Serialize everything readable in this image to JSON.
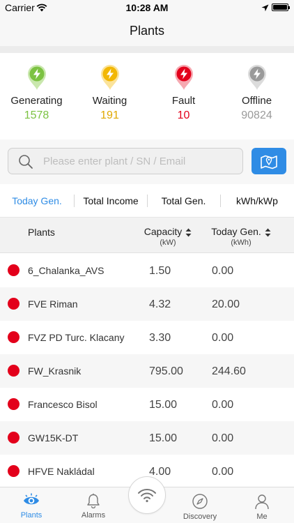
{
  "status_bar": {
    "carrier": "Carrier",
    "time": "10:28 AM"
  },
  "nav": {
    "title": "Plants"
  },
  "stats": [
    {
      "label": "Generating",
      "value": "1578",
      "color": "#7cc242",
      "icon": "lightning-pin-icon"
    },
    {
      "label": "Waiting",
      "value": "191",
      "color": "#f2b705",
      "icon": "lightning-pin-icon"
    },
    {
      "label": "Fault",
      "value": "10",
      "color": "#e3001b",
      "icon": "lightning-pin-icon"
    },
    {
      "label": "Offline",
      "value": "90824",
      "color": "#9a9a9a",
      "icon": "lightning-pin-icon"
    }
  ],
  "search": {
    "placeholder": "Please enter plant / SN / Email",
    "value": ""
  },
  "tabs": [
    {
      "label": "Today Gen.",
      "active": true
    },
    {
      "label": "Total Income",
      "active": false
    },
    {
      "label": "Total Gen.",
      "active": false
    },
    {
      "label": "kWh/kWp",
      "active": false
    }
  ],
  "table": {
    "col_plants": "Plants",
    "col_capacity": "Capacity",
    "col_capacity_unit": "(kW)",
    "col_today": "Today Gen.",
    "col_today_unit": "(kWh)",
    "rows": [
      {
        "name": "6_Chalanka_AVS",
        "capacity": "1.50",
        "today": "0.00",
        "status": "fault"
      },
      {
        "name": "FVE Riman",
        "capacity": "4.32",
        "today": "20.00",
        "status": "fault"
      },
      {
        "name": "FVZ PD Turc. Klacany",
        "capacity": "3.30",
        "today": "0.00",
        "status": "fault"
      },
      {
        "name": "FW_Krasnik",
        "capacity": "795.00",
        "today": "244.60",
        "status": "fault"
      },
      {
        "name": "Francesco Bisol",
        "capacity": "15.00",
        "today": "0.00",
        "status": "fault"
      },
      {
        "name": "GW15K-DT",
        "capacity": "15.00",
        "today": "0.00",
        "status": "fault"
      },
      {
        "name": "HFVE Nakládal",
        "capacity": "4.00",
        "today": "0.00",
        "status": "fault"
      }
    ]
  },
  "tabbar": {
    "plants": "Plants",
    "alarms": "Alarms",
    "discovery": "Discovery",
    "me": "Me"
  },
  "colors": {
    "accent": "#2f8ce5",
    "fault": "#e3001b"
  }
}
